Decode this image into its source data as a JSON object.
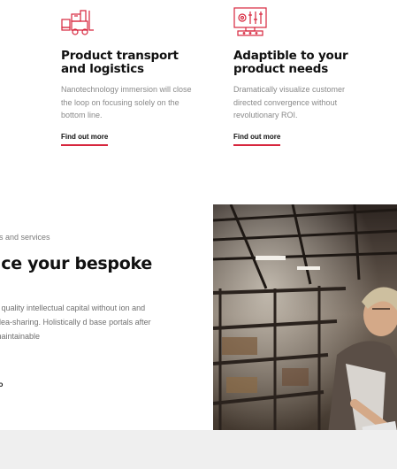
{
  "features": [
    {
      "title": "Product transport and logistics",
      "text": "Nanotechnology immersion will close the loop on focusing solely on the bottom line.",
      "link": "Find out more",
      "icon": "forklift-icon"
    },
    {
      "title": "Adaptible to your product needs",
      "text": "Dramatically visualize customer directed convergence without revolutionary ROI.",
      "link": "Find out more",
      "icon": "control-panel-icon"
    }
  ],
  "about": {
    "eyebrow": "cts and services",
    "heading": "uce your bespoke",
    "text": "e quality intellectual capital without ion and idea-sharing. Holistically d base portals after maintainable",
    "link": "lio"
  },
  "photo": {
    "subject": "warehouse-worker-photo"
  },
  "colors": {
    "accent": "#d7263d",
    "heading": "#111111",
    "muted": "#8a8a8a",
    "band": "#efefef"
  }
}
